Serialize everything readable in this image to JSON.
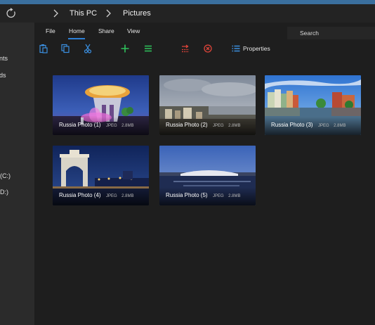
{
  "breadcrumb": {
    "items": [
      "This PC",
      "Pictures"
    ]
  },
  "ribbon": {
    "tabs": [
      "File",
      "Home",
      "Share",
      "View"
    ],
    "active_tab": "Home",
    "properties_label": "Properties"
  },
  "search": {
    "label": "Search"
  },
  "sidebar": {
    "items": [
      "nts",
      "ds",
      "(C:)",
      "D:)"
    ]
  },
  "files": [
    {
      "name": "Russia Photo (1)",
      "type": "JPEG",
      "size": "2.8MB"
    },
    {
      "name": "Russia Photo (2)",
      "type": "JPEG",
      "size": "2.8MB"
    },
    {
      "name": "Russia Photo (3)",
      "type": "JPEG",
      "size": "2.8MB"
    },
    {
      "name": "Russia Photo (4)",
      "type": "JPEG",
      "size": "2.8MB"
    },
    {
      "name": "Russia Photo (5)",
      "type": "JPEG",
      "size": "2.8MB"
    }
  ],
  "colors": {
    "accent": "#2d7fd6",
    "window_bg": "#1e1e1e",
    "sidebar_bg": "#2b2b2b",
    "icon_blue": "#3b8fe0",
    "icon_green": "#2fc35c",
    "icon_red": "#e0453a"
  },
  "icons": [
    "refresh-icon",
    "chevron-right-icon",
    "paste-icon",
    "copy-icon",
    "cut-icon",
    "new-item-icon",
    "select-all-icon",
    "move-to-icon",
    "delete-icon",
    "properties-icon",
    "search-icon"
  ]
}
